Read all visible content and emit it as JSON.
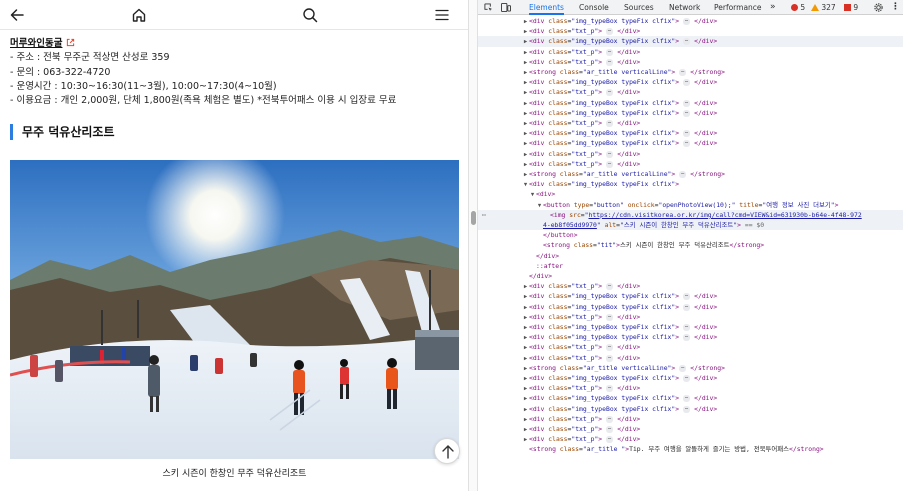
{
  "page": {
    "link_text": "머루와인동굴",
    "info_lines": [
      "- 주소 : 전북 무주군 적상면 산성로 359",
      "- 문의 : 063-322-4720",
      "- 운영시간 : 10:30~16:30(11~3월), 10:00~17:30(4~10월)",
      "- 이용요금 : 개인 2,000원, 단체 1,800원(족욕 체험은 별도) *전북투어패스 이용 시 입장료 무료"
    ],
    "section_title": "무주 덕유산리조트",
    "photo_alt": "스키 시즌이 한창인 무주 덕유산리조트",
    "caption": "스키 시즌이 한창인 무주 덕유산리조트"
  },
  "devtools": {
    "tabs": [
      "Elements",
      "Console",
      "Sources",
      "Network",
      "Performance"
    ],
    "more": "»",
    "errors": "5",
    "warnings": "327",
    "issues": "9",
    "dom_lines": [
      {
        "kind": "div",
        "cls": "img_typeBox typeFix clfix",
        "indent": 0,
        "tw": "▶",
        "el": true
      },
      {
        "kind": "div",
        "cls": "txt_p",
        "indent": 0,
        "tw": "▶",
        "el": true
      },
      {
        "kind": "div",
        "cls": "img_typeBox typeFix clfix",
        "indent": 0,
        "tw": "▶",
        "el": true
      },
      {
        "kind": "div",
        "cls": "txt_p",
        "indent": 0,
        "tw": "▶",
        "el": true
      },
      {
        "kind": "div",
        "cls": "txt_p",
        "indent": 0,
        "tw": "▶",
        "el": true
      },
      {
        "kind": "strong",
        "cls": "ar_title verticalLine",
        "indent": 0,
        "tw": "▶",
        "el": true
      },
      {
        "kind": "div",
        "cls": "img_typeBox typeFix clfix",
        "indent": 0,
        "tw": "▶",
        "el": true
      },
      {
        "kind": "div",
        "cls": "txt_p",
        "indent": 0,
        "tw": "▶",
        "el": true
      },
      {
        "kind": "div",
        "cls": "img_typeBox typeFix clfix",
        "indent": 0,
        "tw": "▶",
        "el": true
      },
      {
        "kind": "div",
        "cls": "img_typeBox typeFix clfix",
        "indent": 0,
        "tw": "▶",
        "el": true
      },
      {
        "kind": "div",
        "cls": "txt_p",
        "indent": 0,
        "tw": "▶",
        "el": true
      },
      {
        "kind": "div",
        "cls": "img_typeBox typeFix clfix",
        "indent": 0,
        "tw": "▶",
        "el": true
      },
      {
        "kind": "div",
        "cls": "img_typeBox typeFix clfix",
        "indent": 0,
        "tw": "▶",
        "el": true
      },
      {
        "kind": "div",
        "cls": "txt_p",
        "indent": 0,
        "tw": "▶",
        "el": true
      },
      {
        "kind": "div",
        "cls": "txt_p",
        "indent": 0,
        "tw": "▶",
        "el": true
      },
      {
        "kind": "strong",
        "cls": "ar_title verticalLine",
        "indent": 0,
        "tw": "▶",
        "el": true
      },
      {
        "kind": "div",
        "cls": "img_typeBox typeFix clfix",
        "indent": 0,
        "tw": "▼",
        "el": false
      }
    ],
    "expanded": {
      "div_open": "<div>",
      "button_line": {
        "tag": "button",
        "type": "button",
        "onclick": "openPhotoView(10);",
        "title": "여행 정보 사진 더보기"
      },
      "img_src_1": "https://cdn.visitkorea.or.kr/img/call?cmd=VIEW&id=631930b-b64e-4f48-972",
      "img_src_2": "4-eb8f05dd9970",
      "img_alt": "스키 시즌이 한창인 무주 덕유산리조트",
      "eq": "== $0",
      "button_close": "</button>",
      "strong_cls": "tit",
      "strong_text": "스키 시즌이 한창인 무주 덕유산리조트",
      "div_close": "</div>",
      "after": "::after",
      "div_close2": "</div>"
    },
    "dom_lines_after": [
      {
        "kind": "div",
        "cls": "txt_p"
      },
      {
        "kind": "div",
        "cls": "img_typeBox typeFix clfix"
      },
      {
        "kind": "div",
        "cls": "img_typeBox typeFix clfix"
      },
      {
        "kind": "div",
        "cls": "txt_p"
      },
      {
        "kind": "div",
        "cls": "img_typeBox typeFix clfix"
      },
      {
        "kind": "div",
        "cls": "img_typeBox typeFix clfix"
      },
      {
        "kind": "div",
        "cls": "txt_p"
      },
      {
        "kind": "div",
        "cls": "txt_p"
      },
      {
        "kind": "strong",
        "cls": "ar_title verticalLine"
      },
      {
        "kind": "div",
        "cls": "img_typeBox typeFix clfix"
      },
      {
        "kind": "div",
        "cls": "txt_p"
      },
      {
        "kind": "div",
        "cls": "img_typeBox typeFix clfix"
      },
      {
        "kind": "div",
        "cls": "img_typeBox typeFix clfix"
      },
      {
        "kind": "div",
        "cls": "txt_p"
      },
      {
        "kind": "div",
        "cls": "txt_p"
      },
      {
        "kind": "div",
        "cls": "txt_p"
      }
    ],
    "last_line": {
      "cls": "ar_title ",
      "text": "Tip. 무주 여행을 알뜰하게 즐기는 방법, 전북투어패스"
    }
  }
}
